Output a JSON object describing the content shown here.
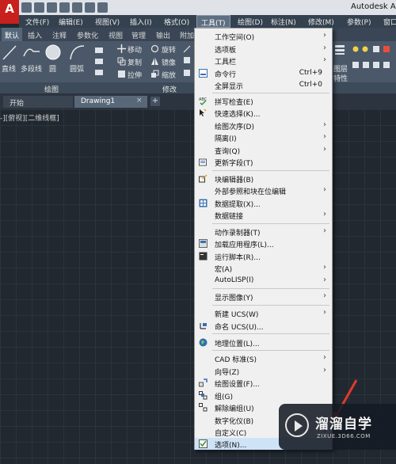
{
  "titlebar": {
    "logo": "A",
    "app_title": "Autodesk Au"
  },
  "menubar": {
    "items": [
      "文件(F)",
      "编辑(E)",
      "视图(V)",
      "插入(I)",
      "格式(O)",
      "工具(T)",
      "绘图(D)",
      "标注(N)",
      "修改(M)",
      "参数(P)",
      "窗口(W)"
    ]
  },
  "ribbon_tabs": [
    "默认",
    "插入",
    "注释",
    "参数化",
    "视图",
    "管理",
    "输出",
    "附加"
  ],
  "ribbon": {
    "draw_tools": [
      "直线",
      "多段线",
      "圆",
      "圆弧"
    ],
    "modify_tools": [
      "移动",
      "旋转",
      "复制",
      "镜像",
      "拉伸",
      "缩放"
    ],
    "right_labels": [
      "图层",
      "特性"
    ],
    "panel_draw": "绘图",
    "panel_modify": "修改"
  },
  "doc_tabs": {
    "start": "开始",
    "drawing": "Drawing1",
    "close": "×",
    "add": "+"
  },
  "viewport_label": "-][俯视][二维线框]",
  "tools_menu": {
    "items": [
      {
        "label": "工作空间(O)",
        "shortcut": "",
        "submenu": true,
        "icon": ""
      },
      {
        "label": "选项板",
        "shortcut": "",
        "submenu": true,
        "icon": ""
      },
      {
        "label": "工具栏",
        "shortcut": "",
        "submenu": true,
        "icon": ""
      },
      {
        "label": "命令行",
        "shortcut": "Ctrl+9",
        "submenu": false,
        "icon": "command-line-icon"
      },
      {
        "label": "全屏显示",
        "shortcut": "Ctrl+0",
        "submenu": false,
        "icon": ""
      },
      {
        "label": "拼写检查(E)",
        "shortcut": "",
        "submenu": false,
        "icon": "spell-check-icon"
      },
      {
        "label": "快速选择(K)...",
        "shortcut": "",
        "submenu": false,
        "icon": "quick-select-icon"
      },
      {
        "label": "绘图次序(D)",
        "shortcut": "",
        "submenu": true,
        "icon": ""
      },
      {
        "label": "隔离(I)",
        "shortcut": "",
        "submenu": true,
        "icon": ""
      },
      {
        "label": "查询(Q)",
        "shortcut": "",
        "submenu": true,
        "icon": ""
      },
      {
        "label": "更新字段(T)",
        "shortcut": "",
        "submenu": false,
        "icon": "update-fields-icon"
      },
      {
        "label": "块编辑器(B)",
        "shortcut": "",
        "submenu": false,
        "icon": "block-editor-icon"
      },
      {
        "label": "外部参照和块在位编辑",
        "shortcut": "",
        "submenu": true,
        "icon": ""
      },
      {
        "label": "数据提取(X)...",
        "shortcut": "",
        "submenu": false,
        "icon": "data-extraction-icon"
      },
      {
        "label": "数据链接",
        "shortcut": "",
        "submenu": true,
        "icon": ""
      },
      {
        "label": "动作录制器(T)",
        "shortcut": "",
        "submenu": true,
        "icon": ""
      },
      {
        "label": "加载应用程序(L)...",
        "shortcut": "",
        "submenu": false,
        "icon": "load-application-icon"
      },
      {
        "label": "运行脚本(R)...",
        "shortcut": "",
        "submenu": false,
        "icon": "run-script-icon"
      },
      {
        "label": "宏(A)",
        "shortcut": "",
        "submenu": true,
        "icon": ""
      },
      {
        "label": "AutoLISP(I)",
        "shortcut": "",
        "submenu": true,
        "icon": ""
      },
      {
        "label": "显示图像(Y)",
        "shortcut": "",
        "submenu": true,
        "icon": ""
      },
      {
        "label": "新建 UCS(W)",
        "shortcut": "",
        "submenu": true,
        "icon": ""
      },
      {
        "label": "命名 UCS(U)...",
        "shortcut": "",
        "submenu": false,
        "icon": "named-ucs-icon"
      },
      {
        "label": "地理位置(L)...",
        "shortcut": "",
        "submenu": false,
        "icon": "geolocation-icon"
      },
      {
        "label": "CAD 标准(S)",
        "shortcut": "",
        "submenu": true,
        "icon": ""
      },
      {
        "label": "向导(Z)",
        "shortcut": "",
        "submenu": true,
        "icon": ""
      },
      {
        "label": "绘图设置(F)...",
        "shortcut": "",
        "submenu": false,
        "icon": "drafting-settings-icon"
      },
      {
        "label": "组(G)",
        "shortcut": "",
        "submenu": false,
        "icon": "group-icon"
      },
      {
        "label": "解除编组(U)",
        "shortcut": "",
        "submenu": false,
        "icon": "ungroup-icon"
      },
      {
        "label": "数字化仪(B)",
        "shortcut": "",
        "submenu": true,
        "icon": ""
      },
      {
        "label": "自定义(C)",
        "shortcut": "",
        "submenu": true,
        "icon": ""
      },
      {
        "label": "选项(N)...",
        "shortcut": "",
        "submenu": false,
        "icon": "options-icon"
      }
    ]
  },
  "watermark": {
    "title": "溜溜自学",
    "url": "ZIXUE.3D66.COM"
  }
}
